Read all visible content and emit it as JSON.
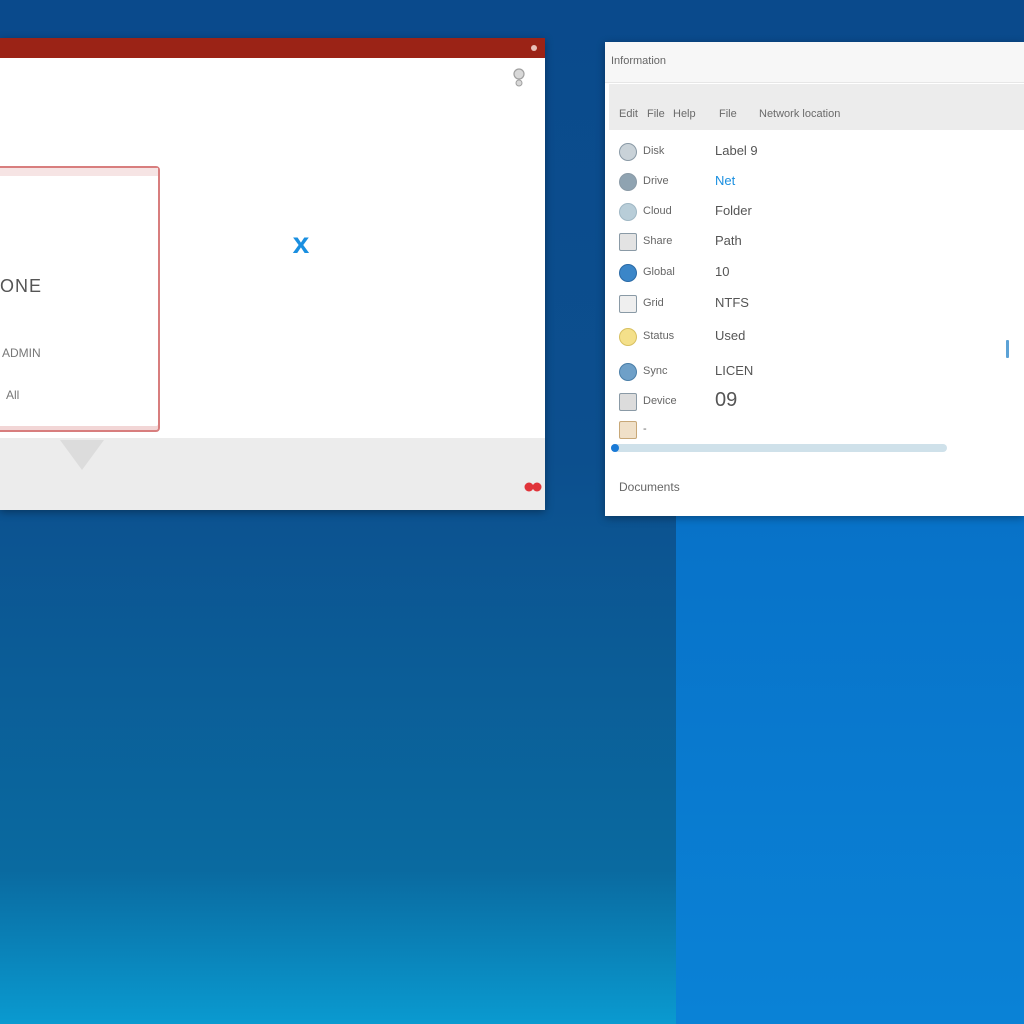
{
  "left_window": {
    "title": "",
    "dialog": {
      "title": "ONE",
      "line1": "ADMIN",
      "line2": "All"
    },
    "close_label": "x"
  },
  "right_window": {
    "title": "Information",
    "toolbar": [
      "Edit",
      "File",
      "Help",
      "File",
      "Network location"
    ],
    "rows": [
      {
        "icon": "disc-icon",
        "label": "Disk",
        "value": "Label 9"
      },
      {
        "icon": "drive-icon",
        "label": "Drive",
        "value": "Net",
        "accent": true
      },
      {
        "icon": "cloud-icon",
        "label": "Cloud",
        "value": "Folder"
      },
      {
        "icon": "network-icon",
        "label": "Share",
        "value": "Path"
      },
      {
        "icon": "globe-icon",
        "label": "Global",
        "value": "10"
      },
      {
        "icon": "grid-icon",
        "label": "Grid",
        "value": "NTFS"
      },
      {
        "icon": "light-icon",
        "label": "Status",
        "value": "Used"
      },
      {
        "icon": "sync-icon",
        "label": "Sync",
        "value": "LICEN"
      },
      {
        "icon": "device-icon",
        "label": "Device",
        "value": "09"
      },
      {
        "icon": "folder-icon",
        "label": "-",
        "value": ""
      }
    ],
    "progress": 0.01,
    "status": "Documents"
  },
  "colors": {
    "left_titlebar": "#9b2316",
    "accent_blue": "#1a8fe0",
    "card_border": "#d87e7e"
  }
}
